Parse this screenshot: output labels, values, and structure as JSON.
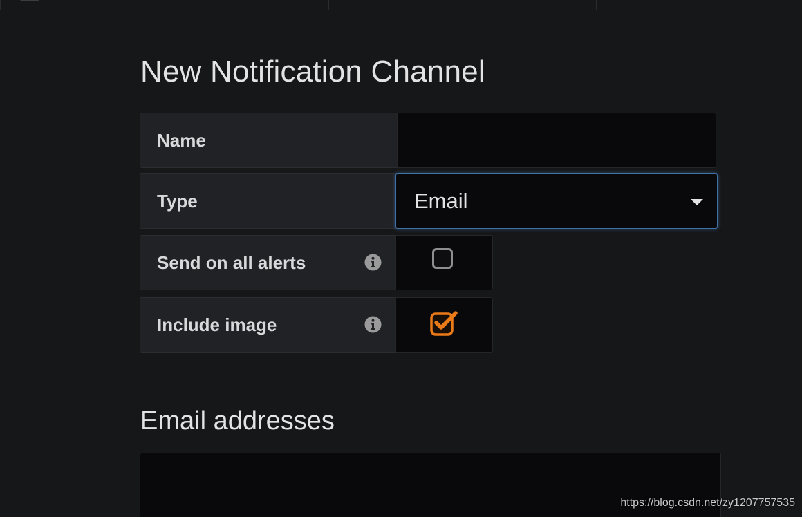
{
  "page": {
    "title": "New Notification Channel"
  },
  "form": {
    "name": {
      "label": "Name",
      "value": "",
      "placeholder": ""
    },
    "type": {
      "label": "Type",
      "selected": "Email"
    },
    "send_on_all_alerts": {
      "label": "Send on all alerts",
      "checked": false
    },
    "include_image": {
      "label": "Include image",
      "checked": true
    }
  },
  "email_section": {
    "title": "Email addresses",
    "value": ""
  },
  "watermark": "https://blog.csdn.net/zy1207757535",
  "colors": {
    "background": "#161719",
    "label_bg": "#212226",
    "input_bg": "#09090b",
    "focus_border": "#3d71a8",
    "checkbox_accent": "#eb7b18"
  }
}
